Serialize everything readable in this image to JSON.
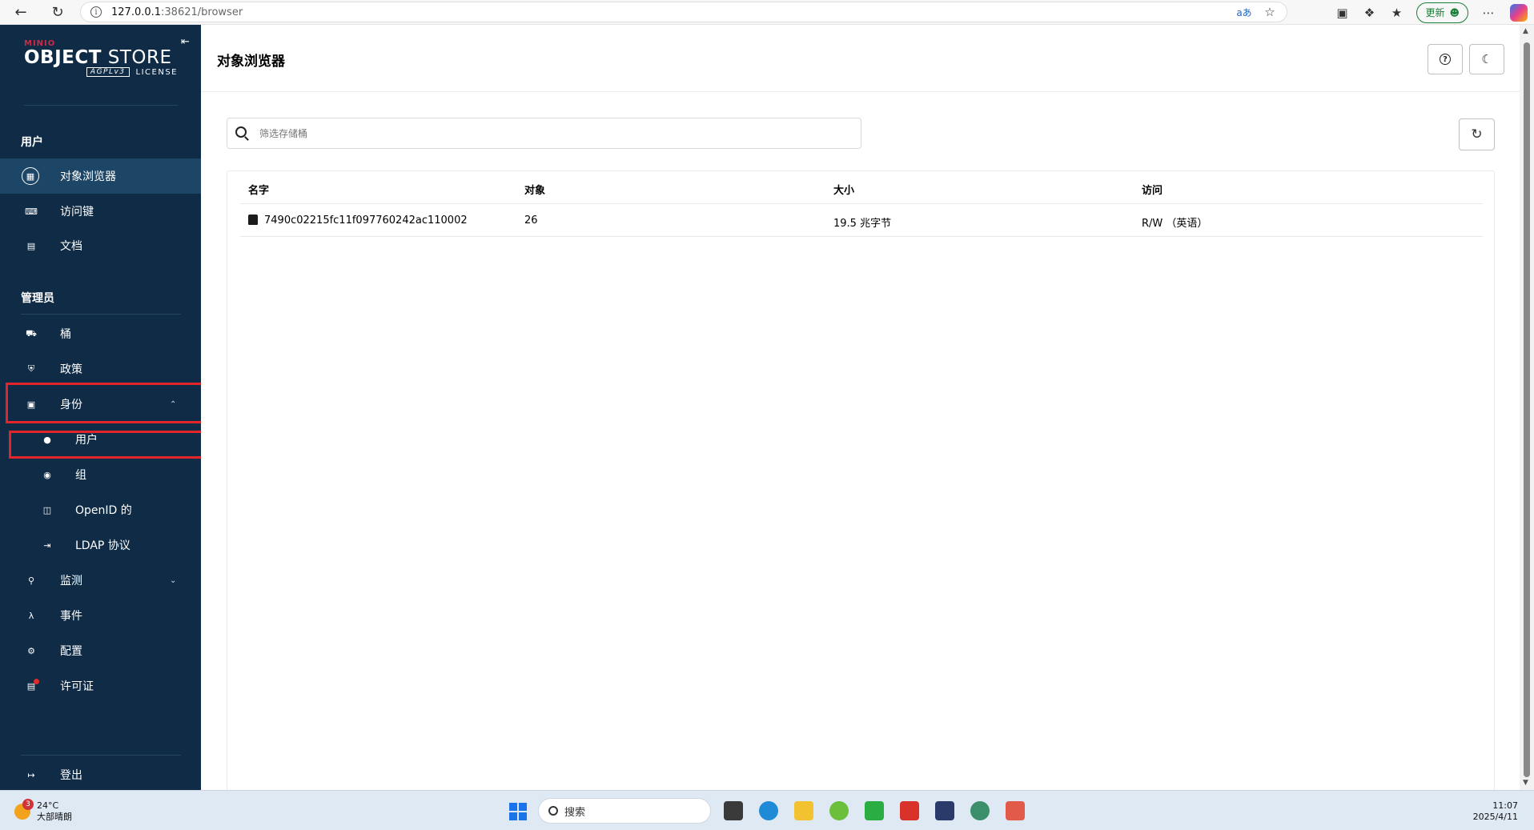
{
  "browser": {
    "url_host": "127.0.0.1",
    "url_path": ":38621/browser",
    "update_label": "更新"
  },
  "sidebar": {
    "brand_small": "MINIO",
    "brand_bold": "OBJECT",
    "brand_rest": " STORE",
    "license_tag": "AGPLv3",
    "license_text": "LICENSE",
    "section_user": "用户",
    "section_admin": "管理员",
    "items": {
      "object_browser": "对象浏览器",
      "access_keys": "访问键",
      "docs": "文档",
      "buckets": "桶",
      "policies": "政策",
      "identity": "身份",
      "users": "用户",
      "groups": "组",
      "openid": "OpenID 的",
      "ldap": "LDAP 协议",
      "monitoring": "监测",
      "events": "事件",
      "configuration": "配置",
      "license": "许可证",
      "logout": "登出"
    }
  },
  "main": {
    "page_title": "对象浏览器",
    "search_placeholder": "筛选存储桶",
    "columns": [
      "名字",
      "对象",
      "大小",
      "访问"
    ],
    "rows": [
      {
        "name": "7490c02215fc11f097760242ac110002",
        "objects": "26",
        "size": "19.5 兆字节",
        "access": "R/W （英语）"
      }
    ]
  },
  "taskbar": {
    "temperature": "24°C",
    "weather": "大部晴朗",
    "weather_badge": "3",
    "search_label": "搜索",
    "time": "11:07",
    "date": "2025/4/11"
  },
  "colors": {
    "sidebar_bg": "#0f2b45",
    "sidebar_active": "#1c4566",
    "brand_red": "#c72c48",
    "highlight_red": "#e1252a"
  }
}
